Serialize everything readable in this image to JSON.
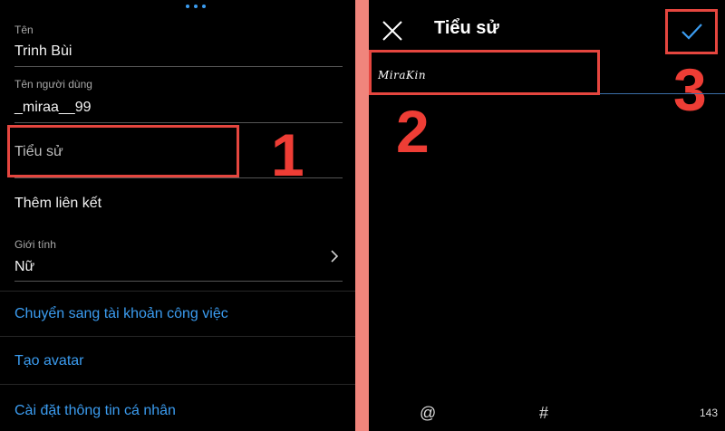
{
  "left_panel": {
    "name_label": "Tên",
    "name_value": "Trinh Bùi",
    "username_label": "Tên người dùng",
    "username_value": "_miraa__99",
    "bio_placeholder": "Tiểu sử",
    "add_link": "Thêm liên kết",
    "gender_label": "Giới tính",
    "gender_value": "Nữ",
    "links": [
      "Chuyển sang tài khoản công việc",
      "Tạo avatar",
      "Cài đặt thông tin cá nhân"
    ]
  },
  "right_panel": {
    "title": "Tiểu sử",
    "bio_value": "MiraKin",
    "keyboard_keys": [
      "@",
      "#"
    ],
    "char_count": "143"
  },
  "annotations": {
    "step1": "1",
    "step2": "2",
    "step3": "3"
  },
  "colors": {
    "background": "#000000",
    "divider": "#f0857c",
    "accent_blue": "#3b9cf0",
    "annotation_red": "#ee3d35"
  },
  "icons": {
    "close": "close-icon",
    "confirm": "checkmark-icon",
    "chevron": "chevron-right-icon"
  }
}
